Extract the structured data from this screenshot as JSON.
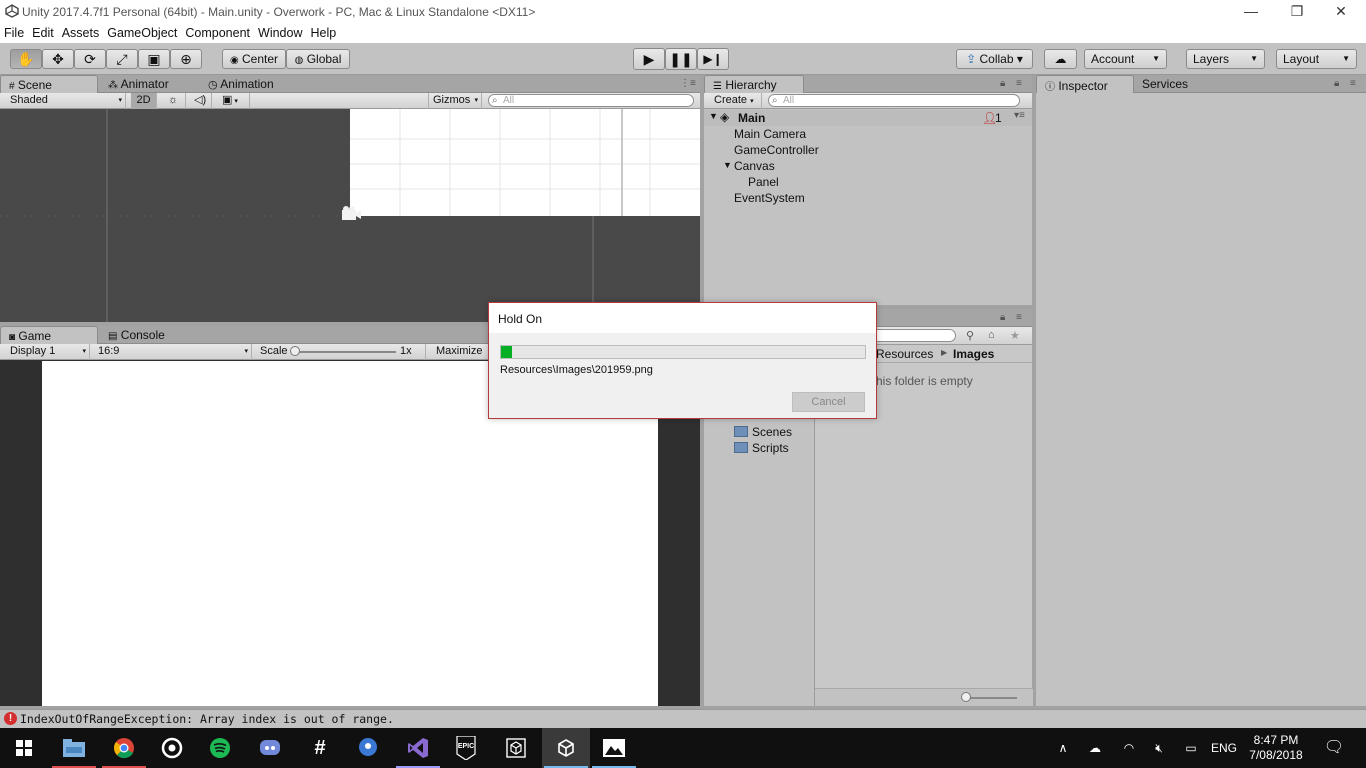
{
  "window": {
    "title": "Unity 2017.4.7f1 Personal (64bit) - Main.unity - Overwork - PC, Mac & Linux Standalone <DX11>",
    "minimize": "—",
    "maximize": "❐",
    "close": "✕"
  },
  "menu": [
    "File",
    "Edit",
    "Assets",
    "GameObject",
    "Component",
    "Window",
    "Help"
  ],
  "toolbar": {
    "pivot": "Center",
    "space": "Global",
    "collab": "Collab ▾",
    "account": "Account",
    "layers": "Layers",
    "layout": "Layout"
  },
  "scene_panel": {
    "tabs": [
      "Scene",
      "Animator",
      "Animation"
    ],
    "shading": "Shaded",
    "mode_2d": "2D",
    "gizmos": "Gizmos",
    "search_placeholder": "All"
  },
  "game_panel": {
    "tabs": [
      "Game",
      "Console"
    ],
    "display": "Display 1",
    "aspect": "16:9",
    "scale_label": "Scale",
    "scale_value": "1x",
    "maximize": "Maximize"
  },
  "hierarchy": {
    "tab": "Hierarchy",
    "create": "Create",
    "search_placeholder": "All",
    "scene_name": "Main",
    "badge_count": "1",
    "items": [
      "Main Camera",
      "GameController",
      "Canvas",
      "Panel",
      "EventSystem"
    ]
  },
  "project": {
    "breadcrumb_parent": "Resources",
    "breadcrumb_current": "Images",
    "empty_message": "his folder is empty",
    "folders": [
      "Scenes",
      "Scripts"
    ]
  },
  "inspector": {
    "tabs": [
      "Inspector",
      "Services"
    ]
  },
  "dialog": {
    "title": "Hold On",
    "progress": 0.03,
    "path": "Resources\\Images\\201959.png",
    "cancel": "Cancel"
  },
  "status": {
    "message": "IndexOutOfRangeException: Array index is out of range."
  },
  "taskbar": {
    "icons": [
      "windows-start",
      "file-explorer",
      "chrome",
      "media-app",
      "spotify",
      "discord",
      "slack",
      "maps",
      "visual-studio",
      "epic-games",
      "unity-hub",
      "unity",
      "photos"
    ],
    "language": "ENG",
    "time": "8:47 PM",
    "date": "7/08/2018"
  },
  "colors": {
    "progress_fill": "#06b025",
    "error": "#d32f2f",
    "scene_bg": "#494949",
    "taskbar_bg": "#101010"
  }
}
